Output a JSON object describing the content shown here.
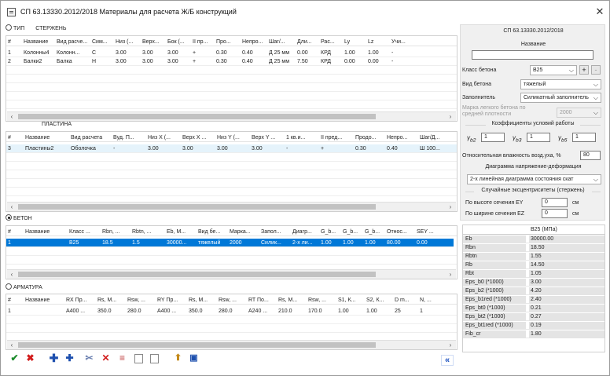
{
  "window": {
    "title": "СП 63.13330.2012/2018  Материалы для расчета Ж/Б конструкций",
    "close": "✕"
  },
  "colors": {
    "selection": "#0078d7",
    "highlight": "#e5f3fb",
    "panel": "#f0f0f0"
  },
  "sections": {
    "type": {
      "label": "ТИП",
      "sub": "СТЕРЖЕНЬ"
    },
    "plate": {
      "label": "ПЛАСТИНА"
    },
    "concrete": {
      "label": "БЕТОН"
    },
    "rebar": {
      "label": "АРМАТУРА"
    }
  },
  "rods": {
    "headers": [
      "#",
      "Название",
      "Вид расче...",
      "Сим...",
      "Низ (...",
      "Верх...",
      "Бок (...",
      "II пр...",
      "Про...",
      "Непро...",
      "Шаг/...",
      "Дли...",
      "Рас...",
      "Ly",
      "Lz",
      "Учи..."
    ],
    "rows": [
      [
        "1",
        "Колонны4",
        "Колонн...",
        "C",
        "3.00",
        "3.00",
        "3.00",
        "+",
        "0.30",
        "0.40",
        "Д 25 мм",
        "0.00",
        "КРД",
        "1.00",
        "1.00",
        "-"
      ],
      [
        "2",
        "Балки2",
        "Балка",
        "H",
        "3.00",
        "3.00",
        "3.00",
        "+",
        "0.30",
        "0.40",
        "Д 25 мм",
        "7.50",
        "КРД",
        "0.00",
        "0.00",
        "-"
      ]
    ]
  },
  "plates": {
    "headers": [
      "#",
      "Название",
      "Вид расчета",
      "Вуд. П...",
      "Низ X (...",
      "Верх X ...",
      "Низ Y (...",
      "Верх Y ...",
      "1 кв.и...",
      "II пред...",
      "Продо...",
      "Непро...",
      "Шаг/Д..."
    ],
    "rows": [
      [
        "3",
        "Пластины2",
        "Оболочка",
        "-",
        "3.00",
        "3.00",
        "3.00",
        "3.00",
        "-",
        "+",
        "0.30",
        "0.40",
        "Ш 100..."
      ]
    ]
  },
  "concrete": {
    "headers": [
      "#",
      "Название",
      "Класс ...",
      "Rbn, ...",
      "Rbtn, ...",
      "Eb, М...",
      "Вид бе...",
      "Марка...",
      "Запол...",
      "Диагр...",
      "G_b...",
      "G_b...",
      "G_b...",
      "Относ...",
      "SEY ..."
    ],
    "rows": [
      [
        "1",
        "",
        "B25",
        "18.5",
        "1.5",
        "30000...",
        "тяжелый",
        "2000",
        "Силик...",
        "2-х ли...",
        "1.00",
        "1.00",
        "1.00",
        "80.00",
        "0.00"
      ]
    ]
  },
  "rebar": {
    "headers": [
      "#",
      "Название",
      "RX Пр...",
      "Rs, М...",
      "Rsw, ...",
      "RY Пр...",
      "Rs, М...",
      "Rsw, ...",
      "RT По...",
      "Rs, М...",
      "Rsw, ...",
      "S1, К...",
      "S2, К...",
      "D m...",
      "N, ..."
    ],
    "rows": [
      [
        "1",
        "",
        "A400 ...",
        "350.0",
        "280.0",
        "A400 ...",
        "350.0",
        "280.0",
        "A240 ...",
        "210.0",
        "170.0",
        "1.00",
        "1.00",
        "25",
        "1"
      ]
    ]
  },
  "toolbar": {
    "icons": [
      "check-icon",
      "cancel-icon",
      "add-icon",
      "add-copy-icon",
      "cut-icon",
      "delete-icon",
      "delete-all-icon",
      "copy-icon",
      "paste-icon",
      "import-icon",
      "save-icon"
    ],
    "collapse": "«"
  },
  "panel": {
    "norm": "СП 63.13330.2012/2018",
    "name_label": "Название",
    "name_value": "",
    "class_label": "Класс бетона",
    "class_value": "B25",
    "type_label": "Вид бетона",
    "type_value": "тяжелый",
    "filler_label": "Заполнитель",
    "filler_value": "Силикатный заполнитель",
    "light_label": "Марка легкого бетона по средней плотности",
    "light_value": "2000",
    "coef_title": "Коэффициенты условий работы",
    "gb2": "1",
    "gb3": "1",
    "gb5": "1",
    "hum_label": "Относительная влажность возд.уха, %",
    "hum_value": "80",
    "diag_title": "Диаграмма напряжение-деформация",
    "diag_value": "2-х линейная диаграмма состояния скат",
    "ecc_title": "Случайные эксцентриситеты  (стержень)",
    "ey_label": "По высоте сечения  EY",
    "ey_value": "0",
    "ez_label": "По ширине сечения EZ",
    "ez_value": "0",
    "unit": "см"
  },
  "props": {
    "header": "B25 (МПа)",
    "rows": [
      [
        "Eb",
        "30000.00"
      ],
      [
        "Rbn",
        "18.50"
      ],
      [
        "Rbtn",
        "1.55"
      ],
      [
        "Rb",
        "14.50"
      ],
      [
        "Rbt",
        "1.05"
      ],
      [
        "Eps_b0 (*1000)",
        "3.00"
      ],
      [
        "Eps_b2 (*1000)",
        "4.20"
      ],
      [
        "Eps_b1red (*1000)",
        "2.40"
      ],
      [
        "Eps_bt0 (*1000)",
        "0.21"
      ],
      [
        "Eps_bt2 (*1000)",
        "0.27"
      ],
      [
        "Eps_bt1red (*1000)",
        "0.19"
      ],
      [
        "Fib_cr",
        "1.80"
      ]
    ]
  }
}
